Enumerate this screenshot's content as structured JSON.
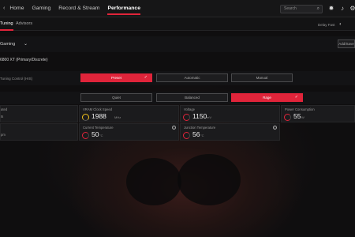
{
  "nav": {
    "back_icon": "chevron-left-icon",
    "items": [
      "Home",
      "Gaming",
      "Record & Stream",
      "Performance"
    ],
    "active": "Performance"
  },
  "search": {
    "placeholder": "Search"
  },
  "top_icons": [
    "bug-icon",
    "bell-icon",
    "gear-icon"
  ],
  "subnav": {
    "tabs": [
      "Tuning",
      "Advisors"
    ],
    "active": "Tuning",
    "status_label": "Delay Fast"
  },
  "profile": {
    "selector_value": "Gaming",
    "export_label": "Add/Save"
  },
  "gpu": {
    "name": "6800 XT (Primary/Discrete)"
  },
  "tuning_control": {
    "label": "Tuning Control (HIS)",
    "options": [
      "Preset",
      "Automatic",
      "Manual"
    ],
    "selected": "Preset"
  },
  "preset": {
    "options": [
      "Quiet",
      "Balanced",
      "Rage"
    ],
    "selected": "Rage"
  },
  "metrics_labels": {
    "left_top": "ated",
    "left_bottom": "ts",
    "left_bottom2": "pm"
  },
  "metrics": [
    {
      "label": "VRAM Clock Speed",
      "value": "1988",
      "unit": "MHz",
      "color": "#f2c21b"
    },
    {
      "label": "Voltage",
      "value": "1150",
      "unit": "mV",
      "color": "#e0243a"
    },
    {
      "label": "Power Consumption",
      "value": "55",
      "unit": "W",
      "color": "#e0243a"
    },
    {
      "label": "Current Temperature",
      "value": "50",
      "unit": "°C",
      "color": "#e0243a"
    },
    {
      "label": "Junction Temperature",
      "value": "56",
      "unit": "°C",
      "color": "#e0243a"
    }
  ]
}
